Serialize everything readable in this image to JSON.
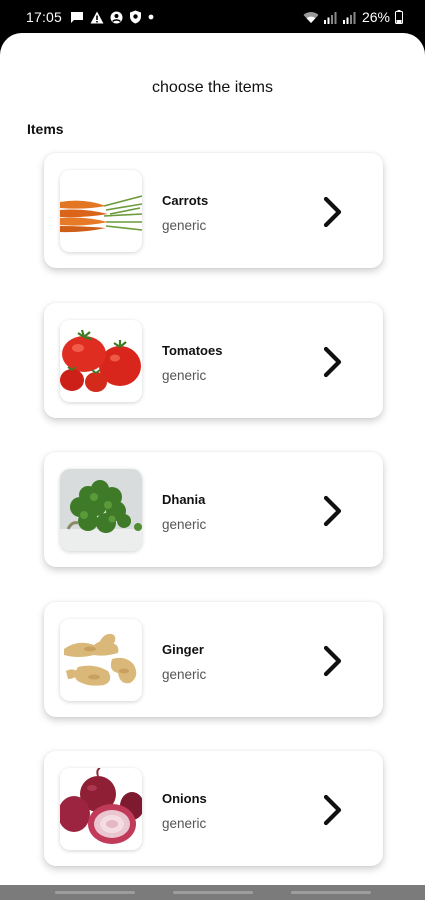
{
  "status_bar": {
    "time": "17:05",
    "left_icons": [
      "message-icon",
      "warning-icon",
      "circle-badge-icon",
      "shield-icon",
      "dot-icon"
    ],
    "right_icons": [
      "wifi-icon",
      "signal-icon",
      "signal-icon",
      "battery-icon"
    ],
    "battery": "26%"
  },
  "sheet": {
    "title": "choose the items",
    "section_label": "Items",
    "items": [
      {
        "name": "Carrots",
        "subtitle": "generic",
        "image": "carrots-image"
      },
      {
        "name": "Tomatoes",
        "subtitle": "generic",
        "image": "tomatoes-image"
      },
      {
        "name": "Dhania",
        "subtitle": "generic",
        "image": "dhania-image"
      },
      {
        "name": "Ginger",
        "subtitle": "generic",
        "image": "ginger-image"
      },
      {
        "name": "Onions",
        "subtitle": "generic",
        "image": "onions-image"
      }
    ]
  },
  "colors": {
    "background": "#ffffff",
    "text": "#111111",
    "subtext": "#555555",
    "status_bar": "#000000",
    "nav_bar": "#7b7b7b"
  }
}
